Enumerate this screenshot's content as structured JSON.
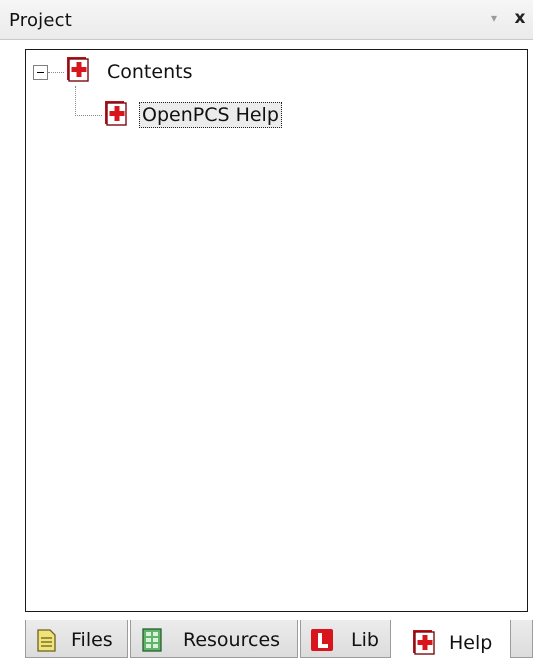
{
  "window": {
    "title": "Project",
    "pin_icon": "dropdown-arrow-icon",
    "close_icon": "close-icon",
    "close_glyph": "x"
  },
  "tree": {
    "root": {
      "label": "Contents",
      "expander": "collapse",
      "icon": "help-book-icon"
    },
    "children": [
      {
        "label": "OpenPCS Help",
        "icon": "help-book-icon",
        "selected": true
      }
    ]
  },
  "tabs": [
    {
      "label": "Files",
      "icon": "files-icon"
    },
    {
      "label": "Resources",
      "icon": "resources-icon"
    },
    {
      "label": "Lib",
      "icon": "lib-icon"
    },
    {
      "label": "Help",
      "icon": "help-book-icon",
      "active": true
    }
  ],
  "colors": {
    "help_red": "#d8141c",
    "files_yellow": "#e6d54a",
    "resources_green": "#3f9a4a"
  }
}
